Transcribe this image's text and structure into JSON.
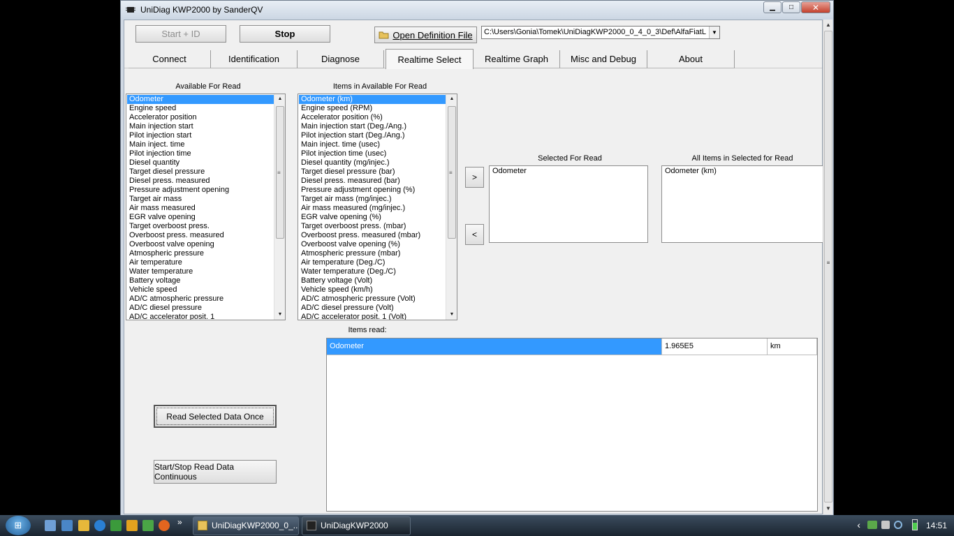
{
  "window": {
    "title": "UniDiag KWP2000 by SanderQV",
    "min_glyph": "▁",
    "max_glyph": "□",
    "close_glyph": "✕"
  },
  "toolbar": {
    "start_id_label": "Start + ID",
    "stop_label": "Stop",
    "open_def_label": "Open Definition File",
    "def_path": "C:\\Users\\Gonia\\Tomek\\UniDiagKWP2000_0_4_0_3\\Def\\AlfaFiatL"
  },
  "tabs": [
    {
      "label": "Connect"
    },
    {
      "label": "Identification"
    },
    {
      "label": "Diagnose"
    },
    {
      "label": "Realtime Select"
    },
    {
      "label": "Realtime Graph"
    },
    {
      "label": "Misc and Debug"
    },
    {
      "label": "About"
    }
  ],
  "available": {
    "title": "Available For Read",
    "items": [
      "Odometer",
      "Engine speed",
      "Accelerator position",
      "Main injection start",
      "Pilot injection start",
      "Main inject. time",
      "Pilot injection time",
      "Diesel quantity",
      "Target diesel pressure",
      "Diesel press. measured",
      "Pressure adjustment opening",
      "Target air mass",
      "Air mass measured",
      "EGR valve opening",
      "Target overboost press.",
      "Overboost press. measured",
      "Overboost valve opening",
      "Atmospheric pressure",
      "Air temperature",
      "Water temperature",
      "Battery voltage",
      "Vehicle speed",
      "AD/C atmospheric pressure",
      "AD/C diesel pressure",
      "AD/C accelerator posit. 1"
    ]
  },
  "available_items": {
    "title": "Items in Available For Read",
    "items": [
      "Odometer (km)",
      "Engine speed (RPM)",
      "Accelerator position (%)",
      "Main injection start (Deg./Ang.)",
      "Pilot injection start (Deg./Ang.)",
      "Main inject. time (usec)",
      "Pilot injection time (usec)",
      "Diesel quantity (mg/injec.)",
      "Target diesel pressure (bar)",
      "Diesel press. measured (bar)",
      "Pressure adjustment opening (%)",
      "Target air mass (mg/injec.)",
      "Air mass measured (mg/injec.)",
      "EGR valve opening (%)",
      "Target overboost press. (mbar)",
      "Overboost press. measured (mbar)",
      "Overboost valve opening (%)",
      "Atmospheric pressure (mbar)",
      "Air temperature (Deg./C)",
      "Water temperature (Deg./C)",
      "Battery voltage (Volt)",
      "Vehicle speed (km/h)",
      "AD/C atmospheric pressure (Volt)",
      "AD/C diesel pressure (Volt)",
      "AD/C accelerator posit. 1 (Volt)"
    ]
  },
  "selected": {
    "title": "Selected For Read",
    "items": [
      "Odometer"
    ]
  },
  "selected_items": {
    "title": "All Items in Selected for Read",
    "items": [
      "Odometer (km)"
    ]
  },
  "move": {
    "add_label": ">",
    "remove_label": "<"
  },
  "items_read": {
    "title": "Items read:",
    "rows": [
      {
        "name": "Odometer",
        "value": "1.965E5",
        "unit": "km"
      }
    ]
  },
  "actions": {
    "read_once_label": "Read Selected Data Once",
    "read_continuous_label": "Start/Stop Read Data Continuous"
  },
  "scroll_glyphs": {
    "up": "▲",
    "down": "▼",
    "grip": "≡"
  },
  "taskbar": {
    "start_glyph": "⊞",
    "more_glyph": "»",
    "buttons": [
      {
        "label": "UniDiagKWP2000_0_..."
      },
      {
        "label": "UniDiagKWP2000"
      }
    ],
    "tray_arrow": "‹",
    "clock": "14:51"
  },
  "colors": {
    "selection": "#3399ff",
    "window_frame": "#cfd8e3"
  }
}
